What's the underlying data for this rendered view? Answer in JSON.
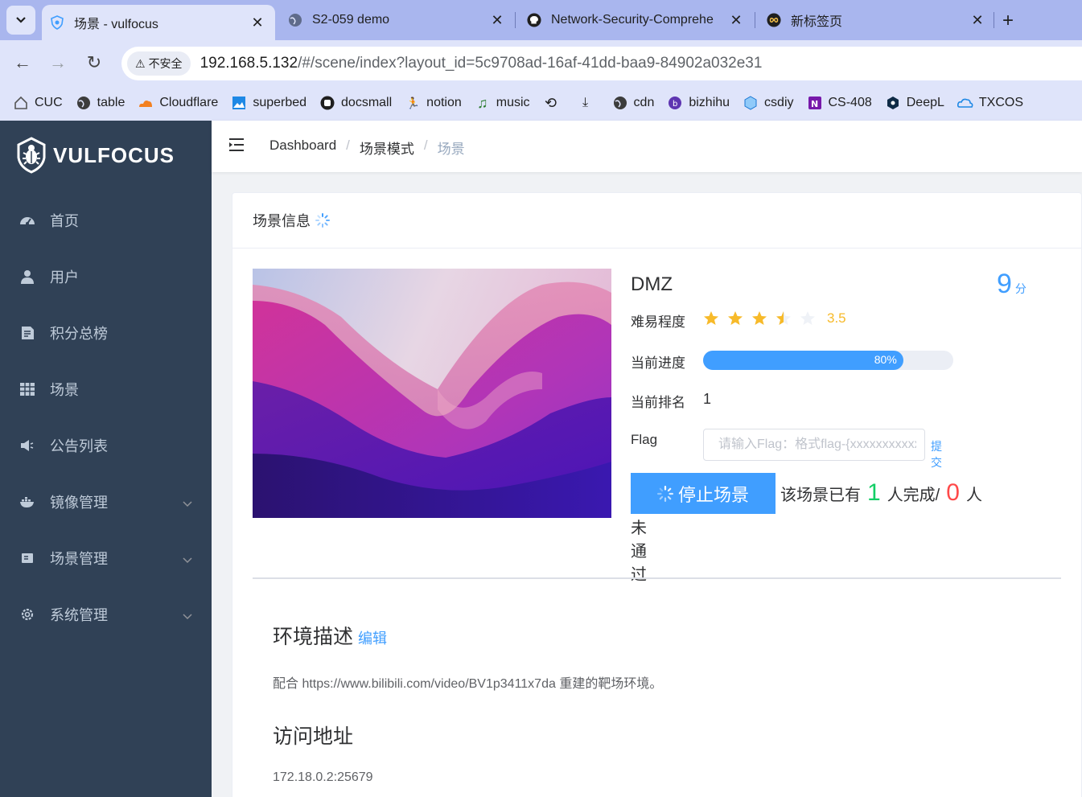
{
  "browser": {
    "tabs": [
      {
        "title": "场景 - vulfocus",
        "icon": "vulfocus-shield-icon",
        "active": true
      },
      {
        "title": "S2-059 demo",
        "icon": "globe-icon",
        "active": false
      },
      {
        "title": "Network-Security-Comprehe",
        "icon": "github-icon",
        "active": false
      },
      {
        "title": "新标签页",
        "icon": "infinity-icon",
        "active": false
      }
    ],
    "security_label": "不安全",
    "url_host": "192.168.5.132",
    "url_path": "/#/scene/index?layout_id=5c9708ad-16af-41dd-baa9-84902a032e31",
    "bookmarks": [
      {
        "label": "CUC",
        "icon": "house-icon"
      },
      {
        "label": "table",
        "icon": "globe-icon"
      },
      {
        "label": "Cloudflare",
        "icon": "cloudflare-icon"
      },
      {
        "label": "superbed",
        "icon": "image-icon"
      },
      {
        "label": "docsmall",
        "icon": "docsmall-icon"
      },
      {
        "label": "notion",
        "icon": "runner-icon"
      },
      {
        "label": "music",
        "icon": "music-note-icon"
      },
      {
        "label": "",
        "icon": "history-icon"
      },
      {
        "label": "",
        "icon": "download-icon"
      },
      {
        "label": "cdn",
        "icon": "globe-icon"
      },
      {
        "label": "bizhihu",
        "icon": "bizhihu-icon"
      },
      {
        "label": "csdiy",
        "icon": "cube-icon"
      },
      {
        "label": "CS-408",
        "icon": "onenote-icon"
      },
      {
        "label": "DeepL",
        "icon": "deepl-icon"
      },
      {
        "label": "TXCOS",
        "icon": "cloud-icon"
      }
    ]
  },
  "sidebar": {
    "logo_text": "VULFOCUS",
    "items": [
      {
        "label": "首页",
        "icon": "dashboard-icon",
        "has_arrow": false
      },
      {
        "label": "用户",
        "icon": "user-icon",
        "has_arrow": false
      },
      {
        "label": "积分总榜",
        "icon": "document-icon",
        "has_arrow": false
      },
      {
        "label": "场景",
        "icon": "grid-icon",
        "has_arrow": false
      },
      {
        "label": "公告列表",
        "icon": "speaker-icon",
        "has_arrow": false
      },
      {
        "label": "镜像管理",
        "icon": "docker-icon",
        "has_arrow": true
      },
      {
        "label": "场景管理",
        "icon": "card-icon",
        "has_arrow": true
      },
      {
        "label": "系统管理",
        "icon": "gear-icon",
        "has_arrow": true
      }
    ]
  },
  "breadcrumb": [
    "Dashboard",
    "场景模式",
    "场景"
  ],
  "card": {
    "header": "场景信息",
    "scene_name": "DMZ",
    "score": "9",
    "score_unit": "分",
    "difficulty_label": "难易程度",
    "rating": 3.5,
    "rating_text": "3.5",
    "progress_label": "当前进度",
    "progress": 0.8,
    "progress_text": "80%",
    "rank_label": "当前排名",
    "rank": "1",
    "flag_label": "Flag",
    "flag_placeholder": "请输入Flag：格式flag-{xxxxxxxxxxxx}",
    "submit_label": "提交",
    "stop_label": "停止场景",
    "completion_prefix": "该场景已有",
    "completed_count": "1",
    "completion_mid": "人完成/",
    "failed_count": "0",
    "completion_suffix": "人",
    "not_passed": "未通过",
    "env_title": "环境描述",
    "edit_label": "编辑",
    "env_desc": "配合 https://www.bilibili.com/video/BV1p3411x7da 重建的靶场环境。",
    "addr_title": "访问地址",
    "addr_value": "172.18.0.2:25679"
  },
  "colors": {
    "sidebar_bg": "#304156",
    "sidebar_text": "#bfcbd9",
    "primary": "#409eff",
    "star": "#f7ba2a",
    "success": "#13ce66",
    "danger": "#ff4949"
  }
}
